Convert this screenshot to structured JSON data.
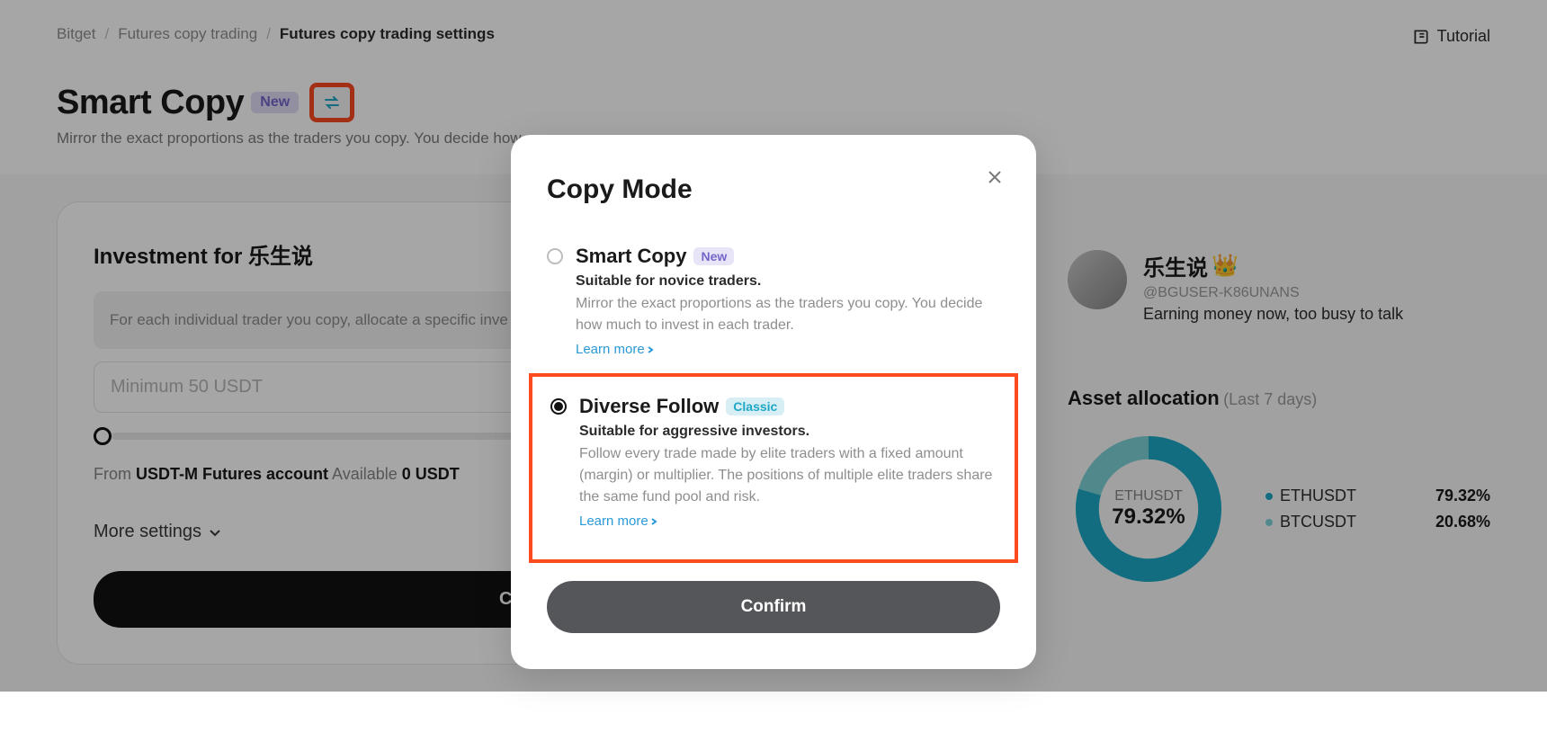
{
  "breadcrumbs": {
    "a": "Bitget",
    "b": "Futures copy trading",
    "c": "Futures copy trading settings"
  },
  "tutorial": "Tutorial",
  "page": {
    "title": "Smart Copy",
    "badge": "New",
    "subtitle": "Mirror the exact proportions as the traders you copy. You decide how"
  },
  "left": {
    "heading": "Investment for 乐生说",
    "info": "For each individual trader you copy, allocate a specific inve",
    "placeholder": "Minimum 50 USDT",
    "from_prefix": "From ",
    "from_account": "USDT-M Futures account",
    "avail_prefix": "   Available ",
    "avail_value": "0 USDT",
    "more": "More settings",
    "copy_btn": "Copy"
  },
  "trader": {
    "name": "乐生说",
    "crown": "👑",
    "handle": "@BGUSER-K86UNANS",
    "bio": "Earning money now, too busy to talk"
  },
  "aa": {
    "title": "Asset allocation",
    "sub": "(Last 7 days)",
    "donut_name": "ETHUSDT",
    "donut_val": "79.32%",
    "legend": [
      {
        "name": "ETHUSDT",
        "val": "79.32%",
        "color": "#1ea8c5"
      },
      {
        "name": "BTCUSDT",
        "val": "20.68%",
        "color": "#7dd1d8"
      }
    ]
  },
  "chart_data": {
    "type": "pie",
    "title": "Asset allocation (Last 7 days)",
    "categories": [
      "ETHUSDT",
      "BTCUSDT"
    ],
    "values": [
      79.32,
      20.68
    ]
  },
  "modal": {
    "title": "Copy Mode",
    "opt1": {
      "name": "Smart Copy",
      "badge": "New",
      "sub": "Suitable for novice traders.",
      "desc": "Mirror the exact proportions as the traders you copy. You decide how much to invest in each trader.",
      "learn": "Learn more"
    },
    "opt2": {
      "name": "Diverse Follow",
      "badge": "Classic",
      "sub": "Suitable for aggressive investors.",
      "desc": "Follow every trade made by elite traders with a fixed amount (margin) or multiplier. The positions of multiple elite traders share the same fund pool and risk.",
      "learn": "Learn more"
    },
    "confirm": "Confirm"
  }
}
